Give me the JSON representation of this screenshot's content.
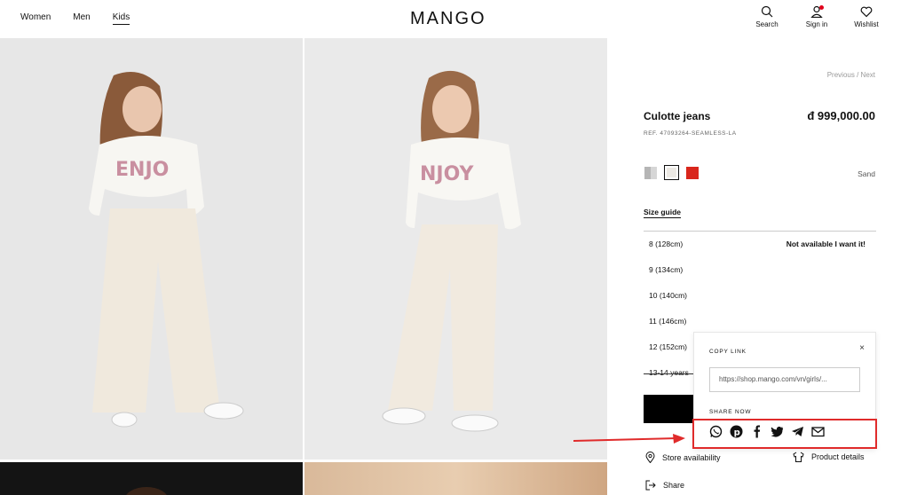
{
  "header": {
    "nav": [
      {
        "label": "Women",
        "active": false
      },
      {
        "label": "Men",
        "active": false
      },
      {
        "label": "Kids",
        "active": true
      }
    ],
    "logo": "MANGO",
    "icons": [
      {
        "label": "Search",
        "icon": "search-icon"
      },
      {
        "label": "Sign in",
        "icon": "user-icon"
      },
      {
        "label": "Wishlist",
        "icon": "heart-icon"
      }
    ]
  },
  "product": {
    "previous": "Previous",
    "separator": "/",
    "next": "Next",
    "name": "Culotte jeans",
    "price": "đ 999,000.00",
    "ref": "REF. 47093264-SEAMLESS-LA",
    "color_name": "Sand",
    "swatch_colors": [
      "#b5b5b5",
      "#ece9e4",
      "#d9261c"
    ],
    "size_guide": "Size guide",
    "sizes": [
      {
        "label": "8 (128cm)",
        "note": "Not available I want it!"
      },
      {
        "label": "9 (134cm)",
        "note": ""
      },
      {
        "label": "10 (140cm)",
        "note": ""
      },
      {
        "label": "11 (146cm)",
        "note": ""
      },
      {
        "label": "12 (152cm)",
        "note": ""
      },
      {
        "label": "13-14 years",
        "note": ""
      }
    ],
    "store_availability": "Store availability",
    "product_details": "Product details",
    "share": "Share"
  },
  "share_popup": {
    "copy_link_label": "COPY LINK",
    "link_value": "https://shop.mango.com/vn/girls/...",
    "share_now_label": "SHARE NOW",
    "close": "×",
    "icons": [
      "whatsapp-icon",
      "pinterest-icon",
      "facebook-icon",
      "twitter-icon",
      "telegram-icon",
      "email-icon"
    ]
  },
  "colors": {
    "highlight": "#e02b2b",
    "accent_red": "#d9261c"
  }
}
